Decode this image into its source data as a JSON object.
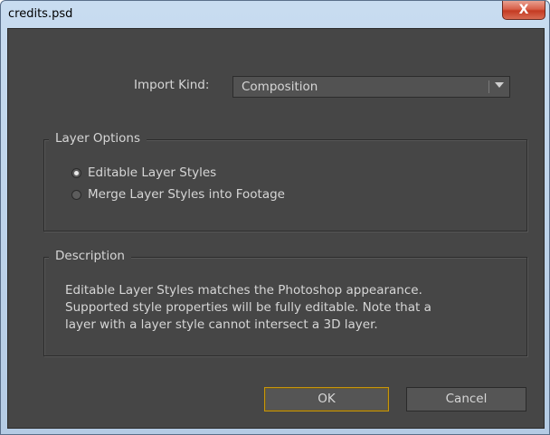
{
  "window": {
    "title": "credits.psd",
    "close_label": "X"
  },
  "import": {
    "label": "Import Kind:",
    "value": "Composition"
  },
  "layer_options": {
    "title": "Layer Options",
    "options": [
      {
        "label": "Editable Layer Styles",
        "selected": true
      },
      {
        "label": "Merge Layer Styles into Footage",
        "selected": false
      }
    ]
  },
  "description": {
    "title": "Description",
    "lines": [
      "Editable Layer Styles matches the Photoshop appearance.",
      "Supported style properties will be fully editable. Note that a",
      "layer with a layer style cannot intersect a 3D layer."
    ]
  },
  "buttons": {
    "ok": "OK",
    "cancel": "Cancel"
  },
  "colors": {
    "dialog_bg": "#464646",
    "ok_focus": "#c8960a",
    "close_red": "#c43a22"
  }
}
